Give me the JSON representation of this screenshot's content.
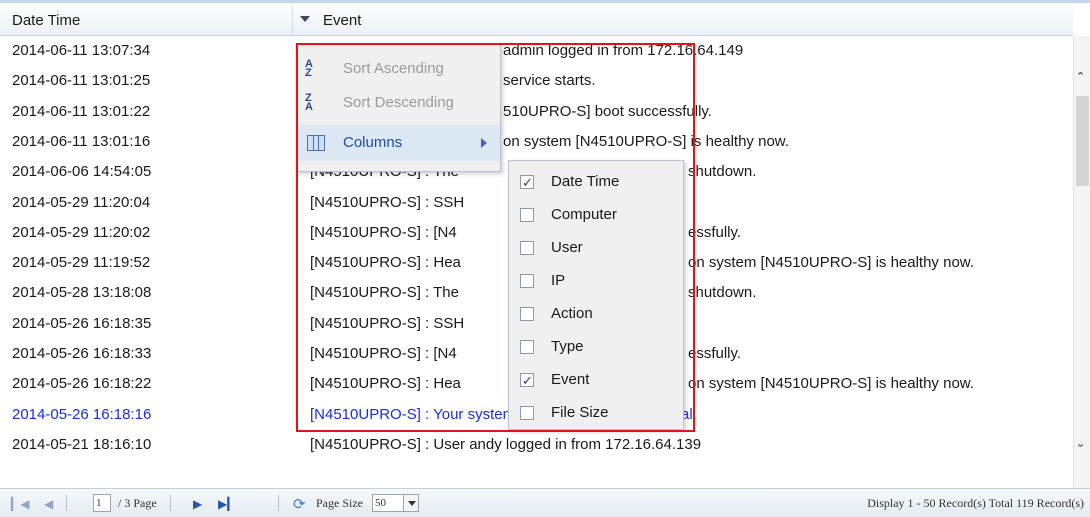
{
  "columns": {
    "date_time": "Date Time",
    "event": "Event"
  },
  "rows": [
    {
      "date": "2014-06-11 13:07:34",
      "event": "admin logged in from 172.16.64.149",
      "highlight": false
    },
    {
      "date": "2014-06-11 13:01:25",
      "event": "service starts.",
      "highlight": false
    },
    {
      "date": "2014-06-11 13:01:22",
      "event": "510UPRO-S] boot successfully.",
      "highlight": false
    },
    {
      "date": "2014-06-11 13:01:16",
      "event": "on system [N4510UPRO-S] is healthy now.",
      "highlight": false
    },
    {
      "date": "2014-06-06 14:54:05",
      "event": "[N4510UPRO-S] : The",
      "tail": "shutdown.",
      "highlight": false
    },
    {
      "date": "2014-05-29 11:20:04",
      "event": "[N4510UPRO-S] : SSH",
      "highlight": false
    },
    {
      "date": "2014-05-29 11:20:02",
      "event": "[N4510UPRO-S] : [N4",
      "tail": "essfully.",
      "highlight": false
    },
    {
      "date": "2014-05-29 11:19:52",
      "event": "[N4510UPRO-S] : Hea",
      "tail": "on system [N4510UPRO-S] is healthy now.",
      "highlight": false
    },
    {
      "date": "2014-05-28 13:18:08",
      "event": "[N4510UPRO-S] : The",
      "tail": "shutdown.",
      "highlight": false
    },
    {
      "date": "2014-05-26 16:18:35",
      "event": "[N4510UPRO-S] : SSH",
      "highlight": false
    },
    {
      "date": "2014-05-26 16:18:33",
      "event": "[N4510UPRO-S] : [N4",
      "tail": "essfully.",
      "highlight": false
    },
    {
      "date": "2014-05-26 16:18:22",
      "event": "[N4510UPRO-S] : Hea",
      "tail": "on system [N4510UPRO-S] is healthy now.",
      "highlight": false
    },
    {
      "date": "2014-05-26 16:18:16",
      "event": "[N4510UPRO-S] : Your system last shutdown is abnormal.",
      "highlight": true
    },
    {
      "date": "2014-05-21 18:16:10",
      "event": "[N4510UPRO-S] : User andy logged in from 172.16.64.139",
      "highlight": false
    }
  ],
  "menu": {
    "sort_asc": "Sort Ascending",
    "sort_desc": "Sort Descending",
    "columns": "Columns",
    "sort_asc_icon_glyph": "A↓Z",
    "sort_desc_icon_glyph": "Z↓A"
  },
  "column_options": [
    {
      "label": "Date Time",
      "checked": true
    },
    {
      "label": "Computer",
      "checked": false
    },
    {
      "label": "User",
      "checked": false
    },
    {
      "label": "IP",
      "checked": false
    },
    {
      "label": "Action",
      "checked": false
    },
    {
      "label": "Type",
      "checked": false
    },
    {
      "label": "Event",
      "checked": true
    },
    {
      "label": "File Size",
      "checked": false
    }
  ],
  "pager": {
    "page_value": "1",
    "page_total": "/ 3 Page",
    "page_size_label": "Page Size",
    "page_size_value": "50",
    "display_info": "Display 1 - 50 Record(s) Total 119 Record(s)"
  },
  "colors": {
    "highlight_row": "#1a2fd6",
    "callout_border": "#e8101b",
    "header_bg": "#ecf1f7"
  }
}
